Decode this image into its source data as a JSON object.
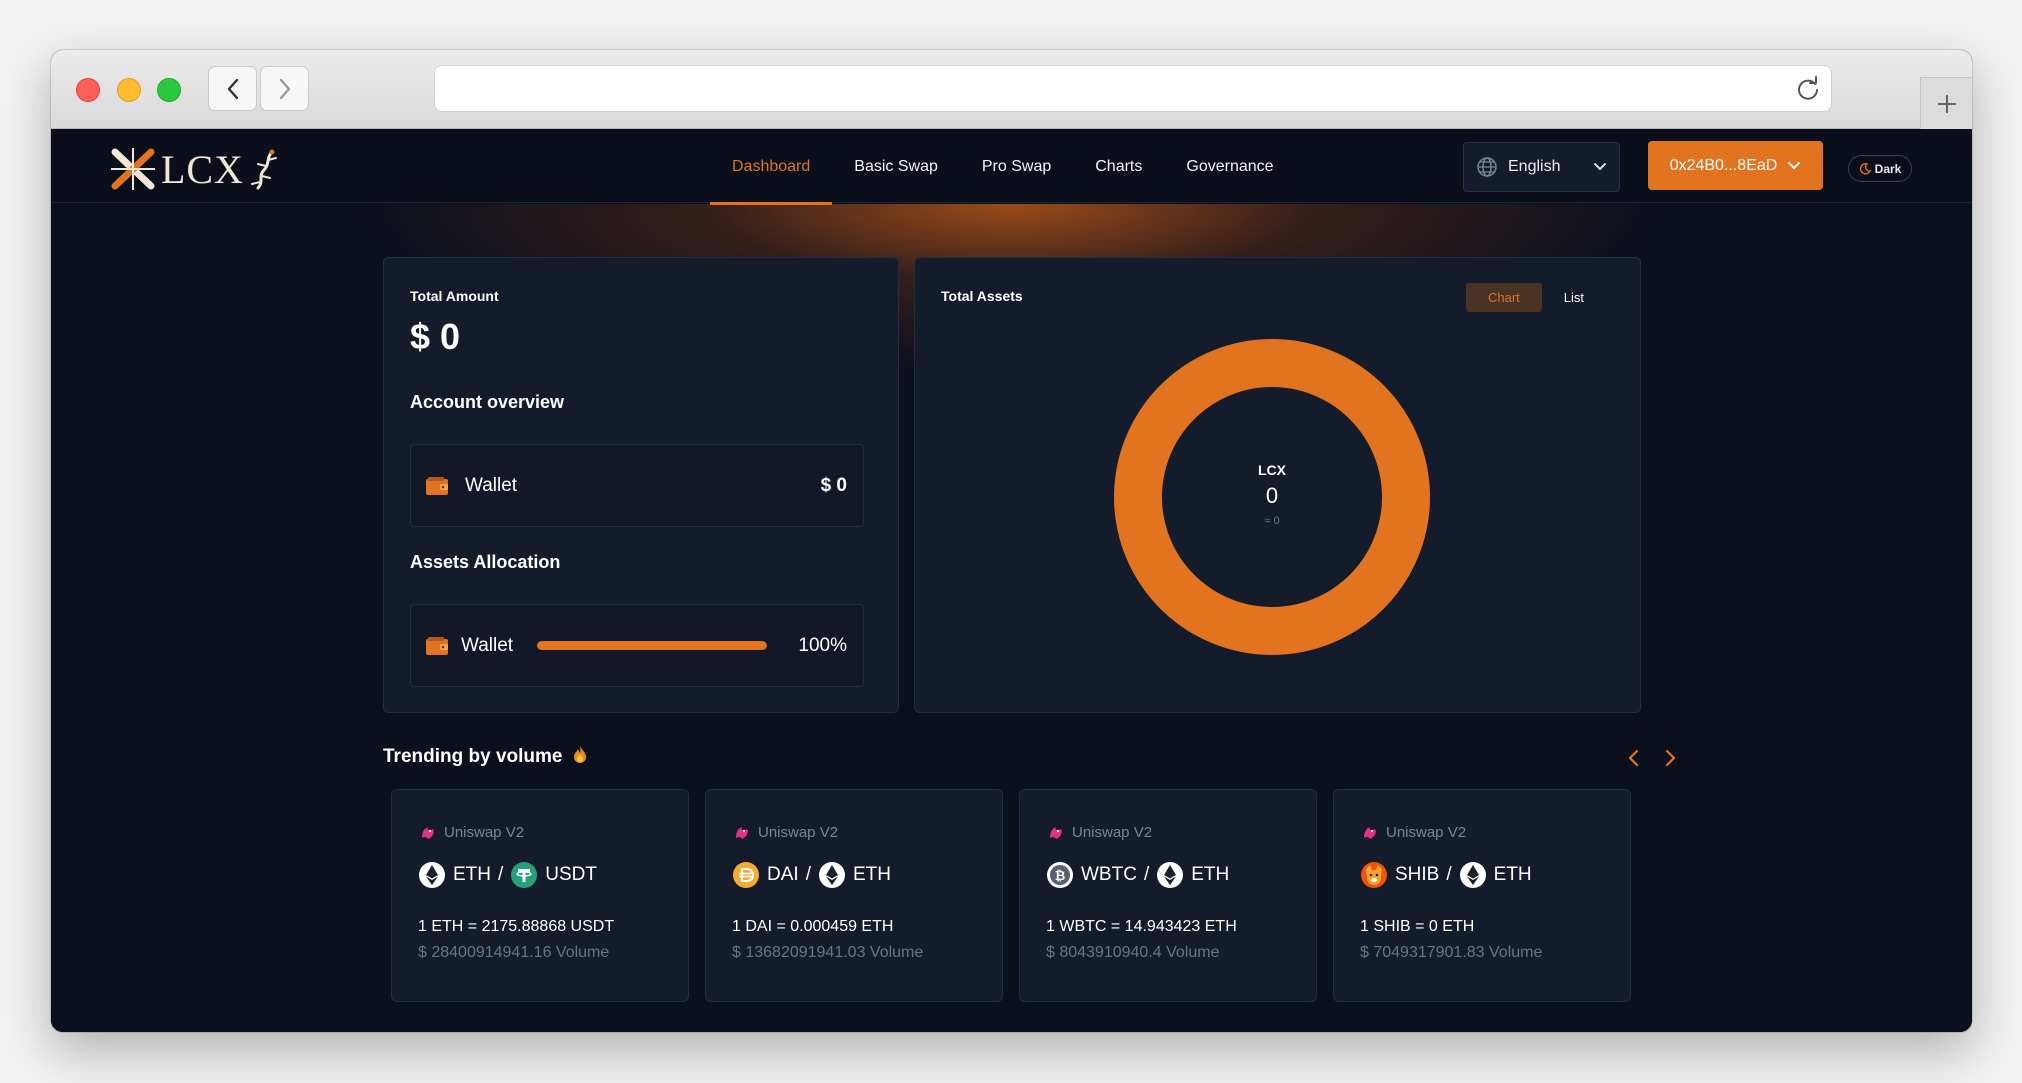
{
  "header": {
    "brand": "LCX",
    "nav": [
      "Dashboard",
      "Basic Swap",
      "Pro Swap",
      "Charts",
      "Governance"
    ],
    "active_nav": "Dashboard",
    "language": "English",
    "wallet_address": "0x24B0...8EaD",
    "theme_label": "Dark"
  },
  "summary": {
    "total_label": "Total Amount",
    "total_value": "$ 0",
    "overview_title": "Account overview",
    "wallet_label": "Wallet",
    "wallet_value": "$ 0",
    "allocation_title": "Assets Allocation",
    "allocation_label": "Wallet",
    "allocation_percent_text": "100%",
    "allocation_fraction": 1.0
  },
  "assets": {
    "title": "Total Assets",
    "toggle": [
      "Chart",
      "List"
    ],
    "active_toggle": "Chart",
    "center_symbol": "LCX",
    "center_value": "0",
    "center_approx": "≈ 0"
  },
  "chart_data": {
    "type": "pie",
    "categories": [
      "LCX"
    ],
    "values": [
      100
    ],
    "colors": [
      "#e2731f"
    ],
    "title": "Total Assets"
  },
  "trending": {
    "title": "Trending by volume",
    "cards": [
      {
        "source": "Uniswap V2",
        "base": "ETH",
        "quote": "USDT",
        "rate": "1 ETH = 2175.88868 USDT",
        "volume": "$ 28400914941.16 Volume"
      },
      {
        "source": "Uniswap V2",
        "base": "DAI",
        "quote": "ETH",
        "rate": "1 DAI = 0.000459 ETH",
        "volume": "$ 13682091941.03 Volume"
      },
      {
        "source": "Uniswap V2",
        "base": "WBTC",
        "quote": "ETH",
        "rate": "1 WBTC = 14.943423 ETH",
        "volume": "$ 8043910940.4 Volume"
      },
      {
        "source": "Uniswap V2",
        "base": "SHIB",
        "quote": "ETH",
        "rate": "1 SHIB = 0 ETH",
        "volume": "$ 7049317901.83 Volume"
      }
    ]
  },
  "colors": {
    "accent": "#e2731f",
    "background": "#0b101d",
    "card": "#141b2b"
  }
}
